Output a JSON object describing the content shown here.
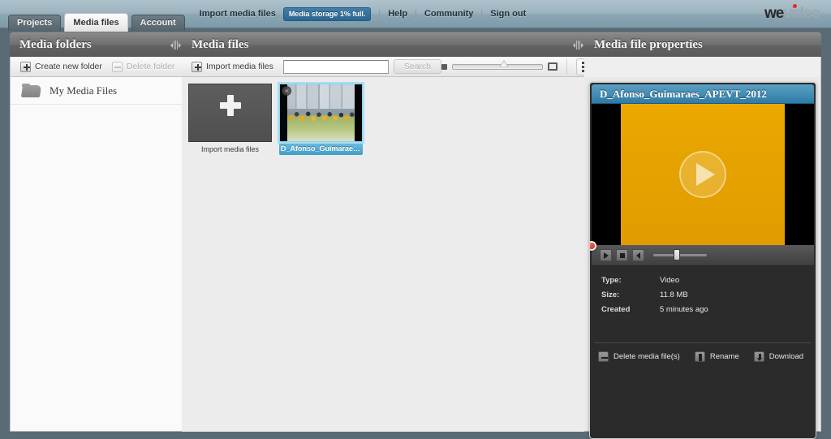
{
  "topbar": {
    "tabs": [
      {
        "label": "Projects",
        "active": false
      },
      {
        "label": "Media files",
        "active": true
      },
      {
        "label": "Account",
        "active": false
      }
    ],
    "import_link": "Import media files",
    "storage_badge": "Media storage 1% full.",
    "links": [
      "Help",
      "Community",
      "Sign out"
    ],
    "separator": "|",
    "logo": {
      "part1": "we",
      "part2": "video",
      "dot_color": "#e03020"
    }
  },
  "panels": {
    "folders": {
      "title": "Media folders",
      "toolbar": {
        "create_label": "Create new folder",
        "delete_label": "Delete folder",
        "delete_disabled": true
      },
      "tree": [
        {
          "label": "My Media Files",
          "icon": "folder-icon"
        }
      ]
    },
    "files": {
      "title": "Media files",
      "toolbar": {
        "import_label": "Import media files",
        "search_value": "",
        "search_placeholder": "",
        "search_button": "Search",
        "size_small_icon": "small-thumbnail-icon",
        "size_large_icon": "large-thumbnail-icon",
        "grid_view_icon": "grid-view-icon",
        "list_view_icon": "list-view-icon",
        "active_view": "grid"
      },
      "tiles": [
        {
          "kind": "import",
          "caption": "Import media files",
          "icon": "plus-icon",
          "selected": false
        },
        {
          "kind": "video",
          "caption": "D_Afonso_Guimaraes...",
          "icon": "film-reel-icon",
          "selected": true
        }
      ]
    },
    "properties": {
      "title": "Media file properties",
      "file_title": "D_Afonso_Guimaraes_APEVT_2012",
      "player": {
        "play_icon": "play-icon",
        "stop_icon": "stop-icon",
        "volume_icon": "volume-icon",
        "overlay_play_icon": "play-overlay-icon",
        "record_dot": "record-dot-icon"
      },
      "meta": [
        {
          "key": "Type:",
          "value": "Video"
        },
        {
          "key": "Size:",
          "value": "11.8 MB"
        },
        {
          "key": "Created",
          "value": "5 minutes ago"
        }
      ],
      "actions": [
        {
          "label": "Delete media file(s)",
          "icon": "delete-icon"
        },
        {
          "label": "Rename",
          "icon": "rename-icon"
        },
        {
          "label": "Download",
          "icon": "download-icon"
        }
      ]
    }
  }
}
